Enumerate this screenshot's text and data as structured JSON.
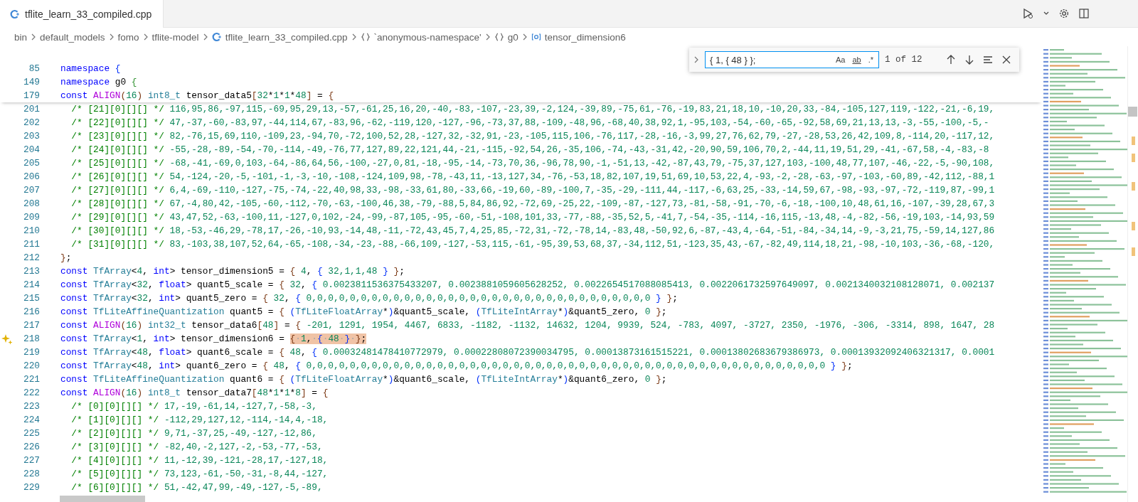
{
  "tabs": [
    {
      "title": "tflite_learn_33_compiled.cpp",
      "selected": true
    }
  ],
  "breadcrumbs": [
    {
      "label": "bin",
      "kind": "folder"
    },
    {
      "label": "default_models",
      "kind": "folder"
    },
    {
      "label": "fomo",
      "kind": "folder"
    },
    {
      "label": "tflite-model",
      "kind": "folder"
    },
    {
      "label": "tflite_learn_33_compiled.cpp",
      "kind": "file"
    },
    {
      "label": "`anonymous-namespace'",
      "kind": "namespace"
    },
    {
      "label": "g0",
      "kind": "namespace"
    },
    {
      "label": "tensor_dimension6",
      "kind": "variable"
    }
  ],
  "find_widget": {
    "query": "{ 1, { 48 } };",
    "options": [
      {
        "label": "Aa",
        "selected": false
      },
      {
        "label": "ab",
        "selected": false
      },
      {
        "label": ".*",
        "selected": false
      }
    ],
    "result": "1 of 12"
  },
  "sticky_lines": [
    {
      "number": "85",
      "tokens": [
        {
          "kind": "keyword",
          "text": "namespace "
        },
        {
          "kind": "bracket1",
          "text": "{"
        }
      ]
    },
    {
      "number": "149",
      "tokens": [
        {
          "kind": "keyword",
          "text": "namespace "
        },
        {
          "kind": "plain",
          "text": "g0 "
        },
        {
          "kind": "bracket2",
          "text": "{"
        }
      ]
    },
    {
      "number": "179",
      "tokens": [
        {
          "kind": "keyword",
          "text": "const "
        },
        {
          "kind": "macro",
          "text": "ALIGN"
        },
        {
          "kind": "bracket3",
          "text": "("
        },
        {
          "kind": "number",
          "text": "16"
        },
        {
          "kind": "bracket3",
          "text": ") "
        },
        {
          "kind": "type",
          "text": "int8_t "
        },
        {
          "kind": "plain",
          "text": "tensor_data5"
        },
        {
          "kind": "bracket3",
          "text": "["
        },
        {
          "kind": "number",
          "text": "32"
        },
        {
          "kind": "plain",
          "text": "*"
        },
        {
          "kind": "number",
          "text": "1"
        },
        {
          "kind": "plain",
          "text": "*"
        },
        {
          "kind": "number",
          "text": "1"
        },
        {
          "kind": "plain",
          "text": "*"
        },
        {
          "kind": "number",
          "text": "48"
        },
        {
          "kind": "bracket3",
          "text": "]"
        },
        {
          "kind": "plain",
          "text": " = "
        },
        {
          "kind": "bracket3",
          "text": "{"
        }
      ]
    }
  ],
  "lines": [
    {
      "number": "201",
      "tokens": [
        {
          "kind": "comment",
          "text": "  /* [21][0][][] */ "
        },
        {
          "kind": "number",
          "text": "116,95,86,-97,115,-69,95,29,13,-57,-61,25,16,20,-40,-83,-107,-23,39,-2,124,-39,89,-75,61,-76,-19,83,21,18,10,-10,20,33,-84,-105,127,119,-122,-21,-6,19,"
        }
      ]
    },
    {
      "number": "202",
      "tokens": [
        {
          "kind": "comment",
          "text": "  /* [22][0][][] */ "
        },
        {
          "kind": "number",
          "text": "47,-37,-60,-83,97,-44,114,67,-83,96,-62,-119,120,-127,-96,-73,37,88,-109,-48,96,-68,40,38,92,1,-95,103,-54,-60,-65,-92,58,69,21,13,13,-3,-55,-100,-5,-"
        }
      ]
    },
    {
      "number": "203",
      "tokens": [
        {
          "kind": "comment",
          "text": "  /* [23][0][][] */ "
        },
        {
          "kind": "number",
          "text": "82,-76,15,69,110,-109,23,-94,70,-72,100,52,28,-127,32,-32,91,-23,-105,115,106,-76,117,-28,-16,-3,99,27,76,62,79,-27,-28,53,26,42,109,8,-114,20,-117,12,"
        }
      ]
    },
    {
      "number": "204",
      "tokens": [
        {
          "kind": "comment",
          "text": "  /* [24][0][][] */ "
        },
        {
          "kind": "number",
          "text": "-55,-28,-89,-54,-70,-114,-49,-76,77,127,89,22,121,44,-21,-115,-92,54,26,-35,106,-74,-43,-31,42,-20,90,59,106,70,2,-44,11,19,51,29,-41,-67,58,-4,-83,-8"
        }
      ]
    },
    {
      "number": "205",
      "tokens": [
        {
          "kind": "comment",
          "text": "  /* [25][0][][] */ "
        },
        {
          "kind": "number",
          "text": "-68,-41,-69,0,103,-64,-86,64,56,-100,-27,0,81,-18,-95,-14,-73,70,36,-96,78,90,-1,-51,13,-42,-87,43,79,-75,37,127,103,-100,48,77,107,-46,-22,-5,-90,108,"
        }
      ]
    },
    {
      "number": "206",
      "tokens": [
        {
          "kind": "comment",
          "text": "  /* [26][0][][] */ "
        },
        {
          "kind": "number",
          "text": "54,-124,-20,-5,-101,-1,-3,-10,-108,-124,109,98,-78,-43,11,-13,127,34,-76,-53,18,82,107,19,51,69,10,53,22,4,-93,-2,-28,-63,-97,-103,-60,89,-42,112,-88,1"
        }
      ]
    },
    {
      "number": "207",
      "tokens": [
        {
          "kind": "comment",
          "text": "  /* [27][0][][] */ "
        },
        {
          "kind": "number",
          "text": "6,4,-69,-110,-127,-75,-74,-22,40,98,33,-98,-33,61,80,-33,66,-19,60,-89,-100,7,-35,-29,-111,44,-117,-6,63,25,-33,-14,59,67,-98,-93,-97,-72,-119,87,-99,1"
        }
      ]
    },
    {
      "number": "208",
      "tokens": [
        {
          "kind": "comment",
          "text": "  /* [28][0][][] */ "
        },
        {
          "kind": "number",
          "text": "67,-4,80,42,-105,-60,-112,-70,-63,-100,46,38,-79,-88,5,84,86,92,-72,69,-25,22,-109,-87,-127,73,-81,-58,-91,-70,-6,-18,-100,10,48,61,16,-107,-39,28,67,3"
        }
      ]
    },
    {
      "number": "209",
      "tokens": [
        {
          "kind": "comment",
          "text": "  /* [29][0][][] */ "
        },
        {
          "kind": "number",
          "text": "43,47,52,-63,-100,11,-127,0,102,-24,-99,-87,105,-95,-60,-51,-108,101,33,-77,-88,-35,52,5,-41,7,-54,-35,-114,-16,115,-13,48,-4,-82,-56,-19,103,-14,93,59"
        }
      ]
    },
    {
      "number": "210",
      "tokens": [
        {
          "kind": "comment",
          "text": "  /* [30][0][][] */ "
        },
        {
          "kind": "number",
          "text": "18,-53,-46,29,-78,17,-26,-10,93,-14,48,-11,-72,43,45,7,4,25,85,-72,31,-72,-78,14,-83,48,-50,92,6,-87,-43,4,-64,-51,-84,-34,14,-9,-3,21,75,-59,14,127,86"
        }
      ]
    },
    {
      "number": "211",
      "tokens": [
        {
          "kind": "comment",
          "text": "  /* [31][0][][] */ "
        },
        {
          "kind": "number",
          "text": "83,-103,38,107,52,64,-65,-108,-34,-23,-88,-66,109,-127,-53,115,-61,-95,39,53,68,37,-34,112,51,-123,35,43,-67,-82,49,114,18,21,-98,-10,103,-36,-68,-120,"
        }
      ]
    },
    {
      "number": "212",
      "tokens": [
        {
          "kind": "bracket3",
          "text": "}"
        },
        {
          "kind": "plain",
          "text": ";"
        }
      ]
    },
    {
      "number": "213",
      "tokens": [
        {
          "kind": "keyword",
          "text": "const "
        },
        {
          "kind": "type",
          "text": "TfArray"
        },
        {
          "kind": "plain",
          "text": "<"
        },
        {
          "kind": "number",
          "text": "4"
        },
        {
          "kind": "plain",
          "text": ", "
        },
        {
          "kind": "keyword",
          "text": "int"
        },
        {
          "kind": "plain",
          "text": "> tensor_dimension5 = "
        },
        {
          "kind": "bracket3",
          "text": "{ "
        },
        {
          "kind": "number",
          "text": "4"
        },
        {
          "kind": "plain",
          "text": ", "
        },
        {
          "kind": "bracket1",
          "text": "{ "
        },
        {
          "kind": "number",
          "text": "32,1,1,48"
        },
        {
          "kind": "bracket1",
          "text": " } "
        },
        {
          "kind": "bracket3",
          "text": "}"
        },
        {
          "kind": "plain",
          "text": ";"
        }
      ]
    },
    {
      "number": "214",
      "tokens": [
        {
          "kind": "keyword",
          "text": "const "
        },
        {
          "kind": "type",
          "text": "TfArray"
        },
        {
          "kind": "plain",
          "text": "<"
        },
        {
          "kind": "number",
          "text": "32"
        },
        {
          "kind": "plain",
          "text": ", "
        },
        {
          "kind": "keyword",
          "text": "float"
        },
        {
          "kind": "plain",
          "text": "> quant5_scale = "
        },
        {
          "kind": "bracket3",
          "text": "{ "
        },
        {
          "kind": "number",
          "text": "32"
        },
        {
          "kind": "plain",
          "text": ", "
        },
        {
          "kind": "bracket1",
          "text": "{ "
        },
        {
          "kind": "number",
          "text": "0.0023811536375433207, 0.0023881059605628252, 0.0022654517088085413, 0.0022061732597649097, 0.0021340032108128071, 0.002137"
        }
      ]
    },
    {
      "number": "215",
      "tokens": [
        {
          "kind": "keyword",
          "text": "const "
        },
        {
          "kind": "type",
          "text": "TfArray"
        },
        {
          "kind": "plain",
          "text": "<"
        },
        {
          "kind": "number",
          "text": "32"
        },
        {
          "kind": "plain",
          "text": ", "
        },
        {
          "kind": "keyword",
          "text": "int"
        },
        {
          "kind": "plain",
          "text": "> quant5_zero = "
        },
        {
          "kind": "bracket3",
          "text": "{ "
        },
        {
          "kind": "number",
          "text": "32"
        },
        {
          "kind": "plain",
          "text": ", "
        },
        {
          "kind": "bracket1",
          "text": "{ "
        },
        {
          "kind": "number",
          "text": "0,0,0,0,0,0,0,0,0,0,0,0,0,0,0,0,0,0,0,0,0,0,0,0,0,0,0,0,0,0,0,0"
        },
        {
          "kind": "bracket1",
          "text": " } "
        },
        {
          "kind": "bracket3",
          "text": "}"
        },
        {
          "kind": "plain",
          "text": ";"
        }
      ]
    },
    {
      "number": "216",
      "tokens": [
        {
          "kind": "keyword",
          "text": "const "
        },
        {
          "kind": "type",
          "text": "TfLiteAffineQuantization"
        },
        {
          "kind": "plain",
          "text": " quant5 = "
        },
        {
          "kind": "bracket3",
          "text": "{ "
        },
        {
          "kind": "bracket1",
          "text": "("
        },
        {
          "kind": "type",
          "text": "TfLiteFloatArray"
        },
        {
          "kind": "plain",
          "text": "*"
        },
        {
          "kind": "bracket1",
          "text": ")"
        },
        {
          "kind": "plain",
          "text": "&quant5_scale, "
        },
        {
          "kind": "bracket1",
          "text": "("
        },
        {
          "kind": "type",
          "text": "TfLiteIntArray"
        },
        {
          "kind": "plain",
          "text": "*"
        },
        {
          "kind": "bracket1",
          "text": ")"
        },
        {
          "kind": "plain",
          "text": "&quant5_zero, "
        },
        {
          "kind": "number",
          "text": "0"
        },
        {
          "kind": "bracket3",
          "text": " }"
        },
        {
          "kind": "plain",
          "text": ";"
        }
      ]
    },
    {
      "number": "217",
      "tokens": [
        {
          "kind": "keyword",
          "text": "const "
        },
        {
          "kind": "macro",
          "text": "ALIGN"
        },
        {
          "kind": "bracket3",
          "text": "("
        },
        {
          "kind": "number",
          "text": "16"
        },
        {
          "kind": "bracket3",
          "text": ") "
        },
        {
          "kind": "type",
          "text": "int32_t "
        },
        {
          "kind": "plain",
          "text": "tensor_data6"
        },
        {
          "kind": "bracket3",
          "text": "["
        },
        {
          "kind": "number",
          "text": "48"
        },
        {
          "kind": "bracket3",
          "text": "]"
        },
        {
          "kind": "plain",
          "text": " = "
        },
        {
          "kind": "bracket3",
          "text": "{ "
        },
        {
          "kind": "number",
          "text": "-201, 1291, 1954, 4467, 6833, -1182, -1132, 14632, 1204, 9939, 524, -783, 4097, -3727, 2350, -1976, -306, -3314, 898, 1647, 28"
        }
      ]
    },
    {
      "number": "218",
      "gutter": {
        "kind": "sparkle"
      },
      "tokens": [
        {
          "kind": "keyword",
          "text": "const "
        },
        {
          "kind": "type",
          "text": "TfArray"
        },
        {
          "kind": "plain",
          "text": "<"
        },
        {
          "kind": "number",
          "text": "1"
        },
        {
          "kind": "plain",
          "text": ", "
        },
        {
          "kind": "keyword",
          "text": "int"
        },
        {
          "kind": "plain",
          "text": "> tensor_dimension6 = "
        },
        {
          "kind": "match",
          "tokens": [
            {
              "kind": "bracket3",
              "text": "{"
            },
            {
              "kind": "whitespace",
              "text": "·"
            },
            {
              "kind": "number",
              "text": "1"
            },
            {
              "kind": "plain",
              "text": ","
            },
            {
              "kind": "whitespace",
              "text": "·"
            },
            {
              "kind": "bracket1",
              "text": "{"
            },
            {
              "kind": "whitespace",
              "text": "·"
            },
            {
              "kind": "number",
              "text": "48"
            },
            {
              "kind": "whitespace",
              "text": "·"
            },
            {
              "kind": "bracket1",
              "text": "}"
            },
            {
              "kind": "whitespace",
              "text": "·"
            },
            {
              "kind": "bracket3",
              "text": "}"
            },
            {
              "kind": "plain",
              "text": ";"
            }
          ]
        }
      ]
    },
    {
      "number": "219",
      "tokens": [
        {
          "kind": "keyword",
          "text": "const "
        },
        {
          "kind": "type",
          "text": "TfArray"
        },
        {
          "kind": "plain",
          "text": "<"
        },
        {
          "kind": "number",
          "text": "48"
        },
        {
          "kind": "plain",
          "text": ", "
        },
        {
          "kind": "keyword",
          "text": "float"
        },
        {
          "kind": "plain",
          "text": "> quant6_scale = "
        },
        {
          "kind": "bracket3",
          "text": "{ "
        },
        {
          "kind": "number",
          "text": "48"
        },
        {
          "kind": "plain",
          "text": ", "
        },
        {
          "kind": "bracket1",
          "text": "{ "
        },
        {
          "kind": "number",
          "text": "0.00032481478410772979, 0.00022808072390034795, 0.00013873161515221, 0.00013802683679386973, 0.00013932092406321317, 0.0001"
        }
      ]
    },
    {
      "number": "220",
      "tokens": [
        {
          "kind": "keyword",
          "text": "const "
        },
        {
          "kind": "type",
          "text": "TfArray"
        },
        {
          "kind": "plain",
          "text": "<"
        },
        {
          "kind": "number",
          "text": "48"
        },
        {
          "kind": "plain",
          "text": ", "
        },
        {
          "kind": "keyword",
          "text": "int"
        },
        {
          "kind": "plain",
          "text": "> quant6_zero = "
        },
        {
          "kind": "bracket3",
          "text": "{ "
        },
        {
          "kind": "number",
          "text": "48"
        },
        {
          "kind": "plain",
          "text": ", "
        },
        {
          "kind": "bracket1",
          "text": "{ "
        },
        {
          "kind": "number",
          "text": "0,0,0,0,0,0,0,0,0,0,0,0,0,0,0,0,0,0,0,0,0,0,0,0,0,0,0,0,0,0,0,0,0,0,0,0,0,0,0,0,0,0,0,0,0,0,0,0"
        },
        {
          "kind": "bracket1",
          "text": " } "
        },
        {
          "kind": "bracket3",
          "text": "}"
        },
        {
          "kind": "plain",
          "text": ";"
        }
      ]
    },
    {
      "number": "221",
      "tokens": [
        {
          "kind": "keyword",
          "text": "const "
        },
        {
          "kind": "type",
          "text": "TfLiteAffineQuantization"
        },
        {
          "kind": "plain",
          "text": " quant6 = "
        },
        {
          "kind": "bracket3",
          "text": "{ "
        },
        {
          "kind": "bracket1",
          "text": "("
        },
        {
          "kind": "type",
          "text": "TfLiteFloatArray"
        },
        {
          "kind": "plain",
          "text": "*"
        },
        {
          "kind": "bracket1",
          "text": ")"
        },
        {
          "kind": "plain",
          "text": "&quant6_scale, "
        },
        {
          "kind": "bracket1",
          "text": "("
        },
        {
          "kind": "type",
          "text": "TfLiteIntArray"
        },
        {
          "kind": "plain",
          "text": "*"
        },
        {
          "kind": "bracket1",
          "text": ")"
        },
        {
          "kind": "plain",
          "text": "&quant6_zero, "
        },
        {
          "kind": "number",
          "text": "0"
        },
        {
          "kind": "bracket3",
          "text": " }"
        },
        {
          "kind": "plain",
          "text": ";"
        }
      ]
    },
    {
      "number": "222",
      "tokens": [
        {
          "kind": "keyword",
          "text": "const "
        },
        {
          "kind": "macro",
          "text": "ALIGN"
        },
        {
          "kind": "bracket3",
          "text": "("
        },
        {
          "kind": "number",
          "text": "16"
        },
        {
          "kind": "bracket3",
          "text": ") "
        },
        {
          "kind": "type",
          "text": "int8_t "
        },
        {
          "kind": "plain",
          "text": "tensor_data7"
        },
        {
          "kind": "bracket3",
          "text": "["
        },
        {
          "kind": "number",
          "text": "48"
        },
        {
          "kind": "plain",
          "text": "*"
        },
        {
          "kind": "number",
          "text": "1"
        },
        {
          "kind": "plain",
          "text": "*"
        },
        {
          "kind": "number",
          "text": "1"
        },
        {
          "kind": "plain",
          "text": "*"
        },
        {
          "kind": "number",
          "text": "8"
        },
        {
          "kind": "bracket3",
          "text": "]"
        },
        {
          "kind": "plain",
          "text": " = "
        },
        {
          "kind": "bracket3",
          "text": "{"
        }
      ]
    },
    {
      "number": "223",
      "tokens": [
        {
          "kind": "comment",
          "text": "  /* [0][0][][] */ "
        },
        {
          "kind": "number",
          "text": "17,-19,-61,14,-127,7,-58,-3,"
        }
      ]
    },
    {
      "number": "224",
      "tokens": [
        {
          "kind": "comment",
          "text": "  /* [1][0][][] */ "
        },
        {
          "kind": "number",
          "text": "-112,29,127,12,-114,-14,4,-18,"
        }
      ]
    },
    {
      "number": "225",
      "tokens": [
        {
          "kind": "comment",
          "text": "  /* [2][0][][] */ "
        },
        {
          "kind": "number",
          "text": "9,71,-37,25,-49,-127,-12,86,"
        }
      ]
    },
    {
      "number": "226",
      "tokens": [
        {
          "kind": "comment",
          "text": "  /* [3][0][][] */ "
        },
        {
          "kind": "number",
          "text": "-82,40,-2,127,-2,-53,-77,-53,"
        }
      ]
    },
    {
      "number": "227",
      "tokens": [
        {
          "kind": "comment",
          "text": "  /* [4][0][][] */ "
        },
        {
          "kind": "number",
          "text": "11,-12,39,-121,-28,17,-127,18,"
        }
      ]
    },
    {
      "number": "228",
      "tokens": [
        {
          "kind": "comment",
          "text": "  /* [5][0][][] */ "
        },
        {
          "kind": "number",
          "text": "73,123,-61,-50,-31,-8,44,-127,"
        }
      ]
    },
    {
      "number": "229",
      "tokens": [
        {
          "kind": "comment",
          "text": "  /* [6][0][][] */ "
        },
        {
          "kind": "number",
          "text": "51,-42,47,99,-49,-127,-5,-89,"
        }
      ]
    }
  ]
}
